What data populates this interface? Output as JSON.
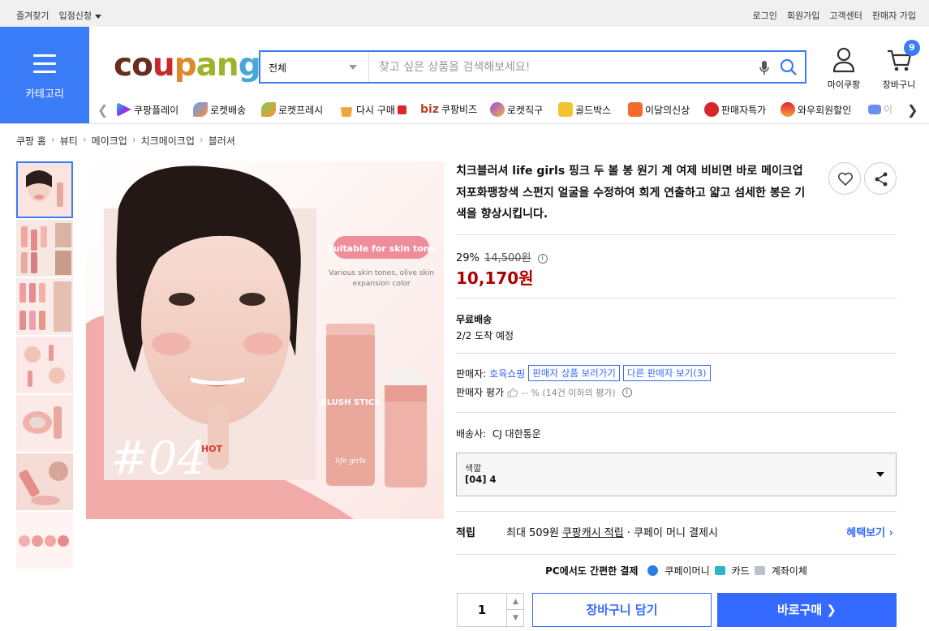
{
  "topbar": {
    "left": [
      "즐겨찾기",
      "입점신청"
    ],
    "right": [
      "로그인",
      "회원가입",
      "고객센터",
      "판매자 가입"
    ]
  },
  "category_label": "카테고리",
  "logo": [
    "co",
    "u",
    "p",
    "an",
    "g"
  ],
  "search": {
    "category": "전체",
    "placeholder": "찾고 싶은 상품을 검색해보세요!"
  },
  "header_icons": {
    "mypage": "마이쿠팡",
    "cart": "장바구니",
    "cart_count": "9"
  },
  "services": [
    "쿠팡플레이",
    "로켓배송",
    "로켓프레시",
    "다시 구매",
    "쿠팡비즈",
    "로켓직구",
    "골드박스",
    "이달의신상",
    "판매자특가",
    "와우회원할인",
    "이"
  ],
  "breadcrumb": [
    "쿠팡 홈",
    "뷰티",
    "메이크업",
    "치크메이크업",
    "블러셔"
  ],
  "image": {
    "badge": "Suitable for skin tone",
    "caption": "Various skin tones, olive skin expansion color",
    "number": "#04",
    "hot": "HOT",
    "stick_text": "BLUSH STICK",
    "brand": "life girls"
  },
  "product": {
    "title": "치크블러셔 life girls 핑크 두 볼 봉 원기 계 여제 비비면 바로 메이크업 저포화팽창색 스펀지 얼굴을 수정하여 희게 연출하고 얇고 섬세한 봉은 기색을 향상시킵니다.",
    "discount": "29%",
    "original_price": "14,500원",
    "price": "10,170원",
    "shipping": "무료배송",
    "arrival": "2/2 도착 예정",
    "seller_label": "판매자:",
    "seller_name": "호육쇼핑",
    "seller_products": "판매자 상품 보러가기",
    "other_sellers": "다른 판매자 보기(3)",
    "seller_rating_label": "판매자 평가",
    "seller_rating": "-- % (14건 이하의 평가)",
    "carrier_label": "배송사:",
    "carrier": "CJ 대한통운",
    "option_key": "색깔",
    "option_value": "[04] 4",
    "reward_label": "적립",
    "reward_text1": "최대 509원",
    "reward_link": "쿠팡캐시 적립",
    "reward_text2": "· 쿠페이 머니 결제시",
    "reward_more": "혜택보기",
    "pay_title": "PC에서도 간편한 결제",
    "pay_options": [
      "쿠페이머니",
      "카드",
      "계좌이체"
    ],
    "quantity": "1",
    "add_to_cart": "장바구니 담기",
    "buy_now": "바로구매"
  },
  "colors": {
    "accent": "#346aff",
    "price": "#ae0000",
    "category_bg": "#3a7bf7"
  }
}
